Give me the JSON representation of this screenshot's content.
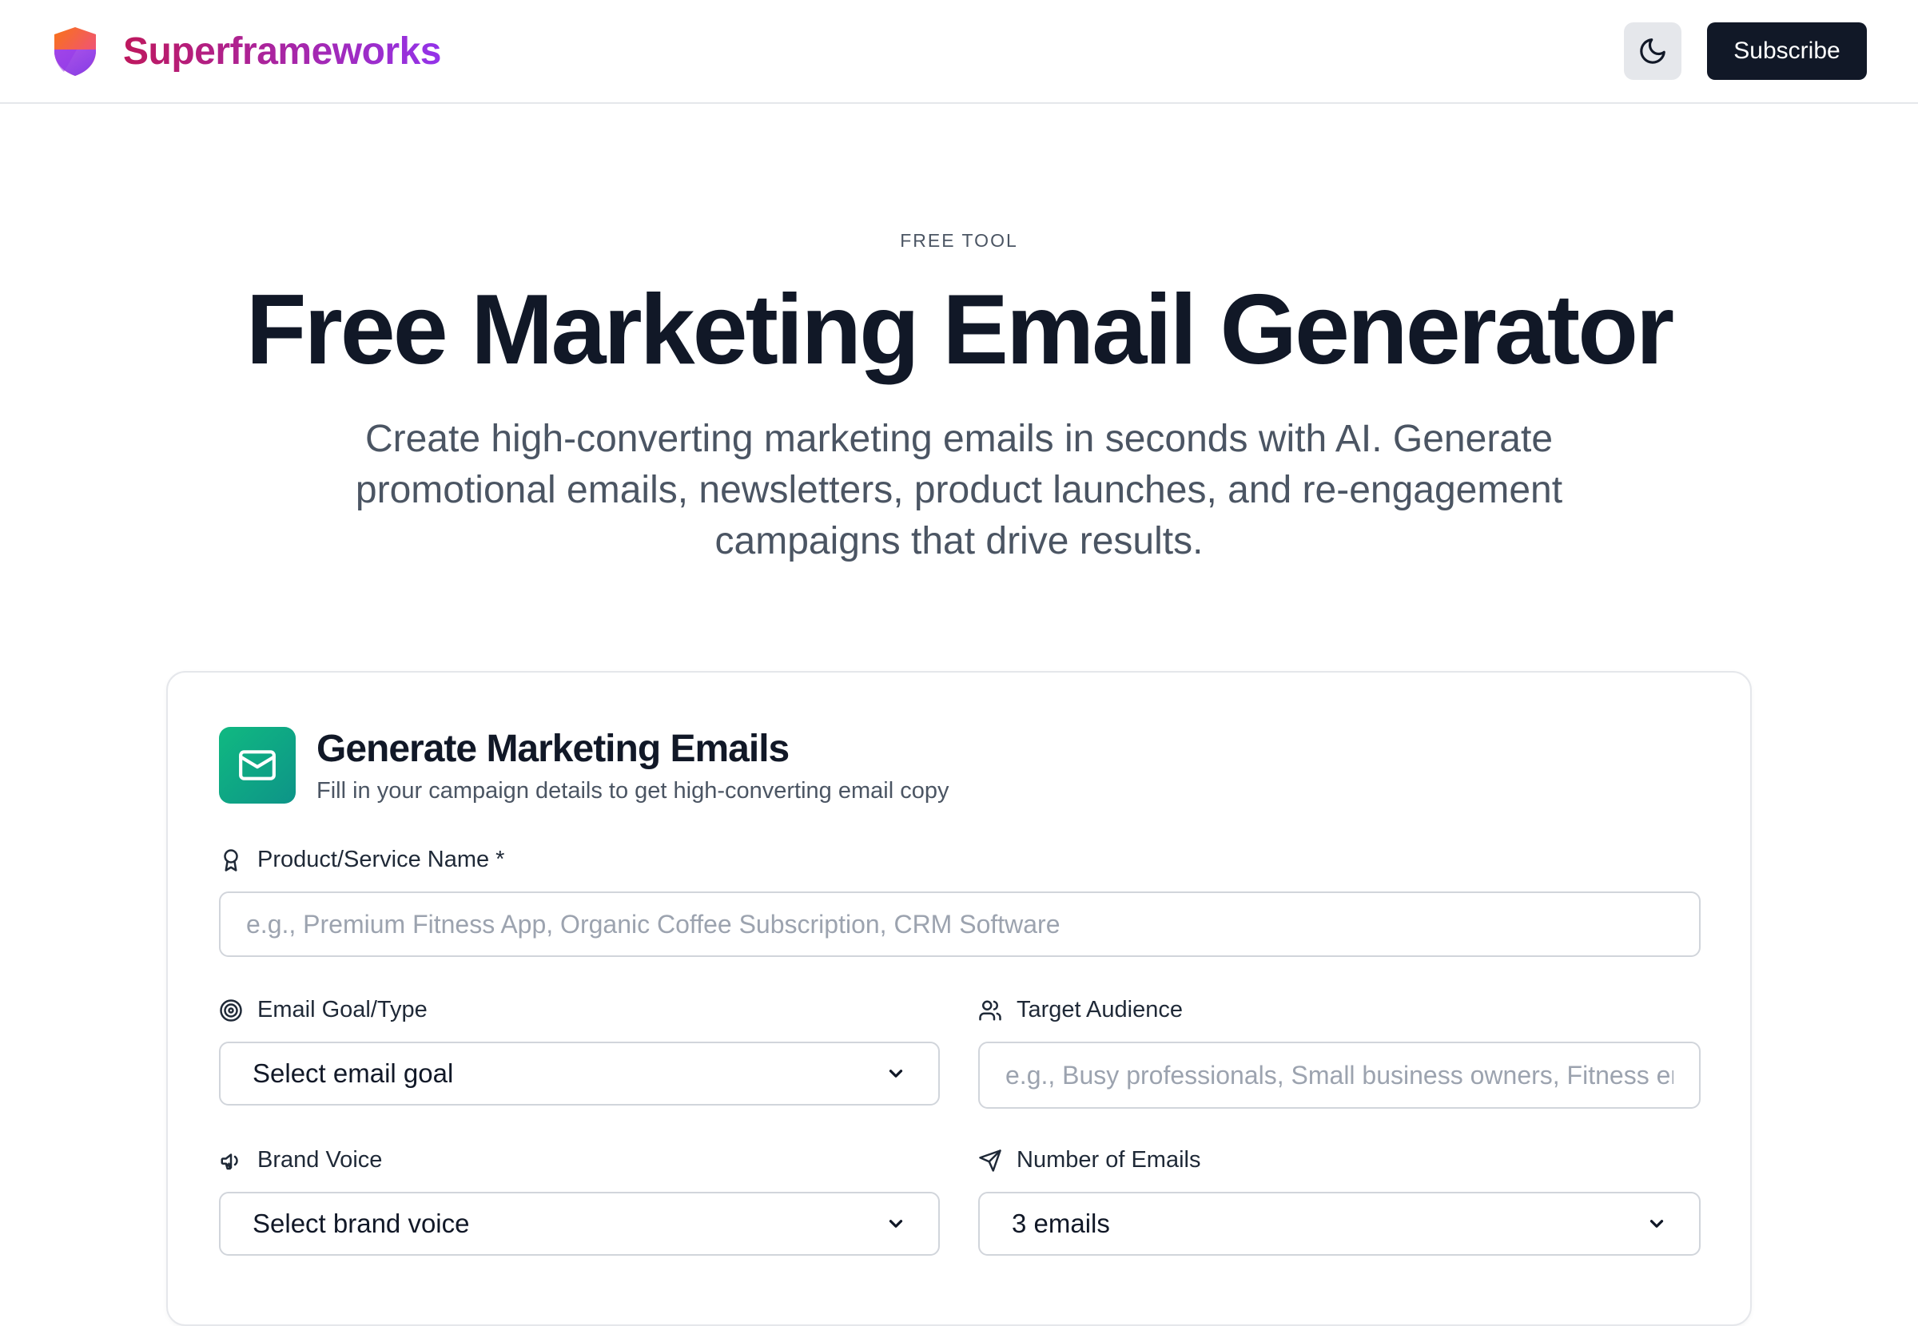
{
  "header": {
    "brand_name": "Superframeworks",
    "subscribe_label": "Subscribe",
    "brand_gradient": [
      "#be185d",
      "#9333ea"
    ]
  },
  "hero": {
    "eyebrow": "FREE TOOL",
    "title": "Free Marketing Email Generator",
    "subtitle": "Create high-converting marketing emails in seconds with AI. Generate promotional emails, newsletters, product launches, and re-engagement campaigns that drive results."
  },
  "card": {
    "title": "Generate Marketing Emails",
    "subtitle": "Fill in your campaign details to get high-converting email copy",
    "accent": "#10b981",
    "fields": {
      "product": {
        "label": "Product/Service Name *",
        "placeholder": "e.g., Premium Fitness App, Organic Coffee Subscription, CRM Software",
        "value": "",
        "icon": "award-icon"
      },
      "goal": {
        "label": "Email Goal/Type",
        "selected": "Select email goal",
        "icon": "target-icon"
      },
      "audience": {
        "label": "Target Audience",
        "placeholder": "e.g., Busy professionals, Small business owners, Fitness enthusiasts",
        "value": "",
        "icon": "users-icon"
      },
      "voice": {
        "label": "Brand Voice",
        "selected": "Select brand voice",
        "icon": "megaphone-icon"
      },
      "count": {
        "label": "Number of Emails",
        "selected": "3 emails",
        "icon": "send-icon"
      }
    }
  }
}
